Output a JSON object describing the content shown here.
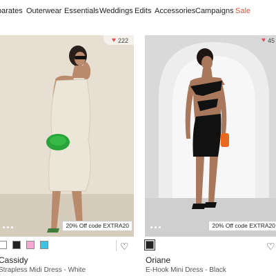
{
  "nav": {
    "items": [
      "parates",
      "Outerwear",
      "Essentials",
      "Weddings",
      "Edits",
      "Accessories",
      "Campaigns",
      "Sale"
    ]
  },
  "products": [
    {
      "likes": "222",
      "promo": "20% Off code EXTRA20",
      "name": "Cassidy",
      "subtitle": "Strapless Midi Dress - White",
      "swatches": [
        "#ffffff",
        "#222222",
        "#f4a9d0",
        "#3fc2e0"
      ]
    },
    {
      "likes": "45",
      "promo": "20% Off code EXTRA20",
      "name": "Oriane",
      "subtitle": "E-Hook Mini Dress - Black",
      "swatches": [
        "#222222"
      ]
    }
  ],
  "colors": {
    "sale": "#e0533d",
    "heart": "#e74c5e"
  }
}
